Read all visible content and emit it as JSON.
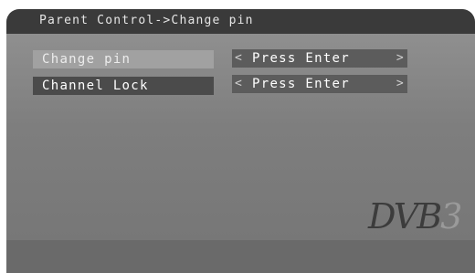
{
  "title": "Parent Control->Change pin",
  "menu": {
    "items": [
      {
        "label": "Change pin",
        "value": "Press Enter",
        "left_arrow": "<",
        "right_arrow": ">"
      },
      {
        "label": "Channel Lock",
        "value": "Press Enter",
        "left_arrow": "<",
        "right_arrow": ">"
      }
    ]
  },
  "logo": {
    "text_main": "DVB",
    "text_fade": "3"
  },
  "colors": {
    "panel": "#8f8f8f",
    "title_bar": "#3a3a3a",
    "selected_row": "#a1a1a1",
    "normal_row": "#4b4b4b"
  }
}
